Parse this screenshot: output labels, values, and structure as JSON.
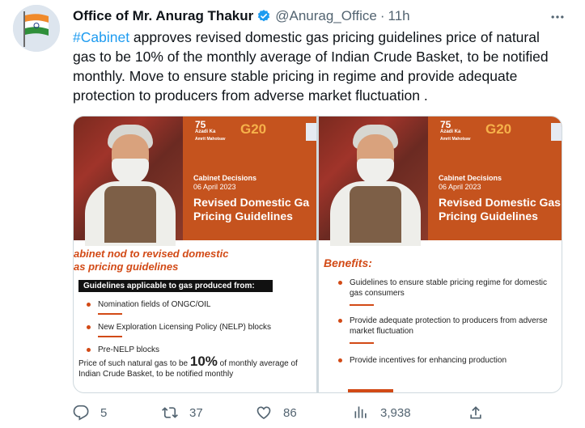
{
  "author": {
    "display_name": "Office of Mr. Anurag Thakur",
    "handle": "@Anurag_Office",
    "separator": "·",
    "time": "11h"
  },
  "tweet": {
    "hashtag": "#Cabinet",
    "text": " approves revised domestic gas pricing guidelines  price of natural gas to be 10% of the monthly average of Indian Crude Basket, to be notified monthly. Move to ensure stable pricing in regime and provide adequate protection to producers from adverse market fluctuation ."
  },
  "media": {
    "left": {
      "logo_azadi_line1": "75",
      "logo_azadi_line2": "Azadi Ka",
      "logo_azadi_line3": "Amrit Mahotsav",
      "logo_g20": "G20",
      "decision_label": "Cabinet Decisions",
      "decision_date": "06 April 2023",
      "title_line1": "Revised Domestic Ga",
      "title_line2": "Pricing Guidelines",
      "heading_line1": "abinet nod to revised domestic",
      "heading_line2": "as pricing guidelines",
      "guidelines_bar": "Guidelines applicable to gas produced from:",
      "items": [
        "Nomination fields of ONGC/OIL",
        "New Exploration Licensing Policy (NELP) blocks",
        "Pre-NELP blocks"
      ],
      "price_prefix": "Price of such natural gas to be ",
      "price_big": "10%",
      "price_suffix": " of monthly average of Indian Crude Basket, to be notified monthly"
    },
    "right": {
      "logo_azadi_line1": "75",
      "logo_azadi_line2": "Azadi Ka",
      "logo_azadi_line3": "Amrit Mahotsav",
      "logo_g20": "G20",
      "decision_label": "Cabinet Decisions",
      "decision_date": "06 April 2023",
      "title_line1": "Revised Domestic Gas",
      "title_line2": "Pricing Guidelines",
      "benefits_heading": "Benefits:",
      "items": [
        "Guidelines to ensure stable pricing regime for domestic gas consumers",
        "Provide adequate protection to producers from adverse market fluctuation",
        "Provide incentives for enhancing production"
      ]
    }
  },
  "actions": {
    "replies": "5",
    "retweets": "37",
    "likes": "86",
    "views": "3,938"
  },
  "icons": [
    "verified-badge-icon",
    "more-icon",
    "reply-icon",
    "retweet-icon",
    "like-icon",
    "views-icon",
    "share-icon"
  ],
  "colors": {
    "accent": "#1d9bf0",
    "text": "#0f1419",
    "muted": "#536471",
    "card_orange": "#c5531e"
  }
}
